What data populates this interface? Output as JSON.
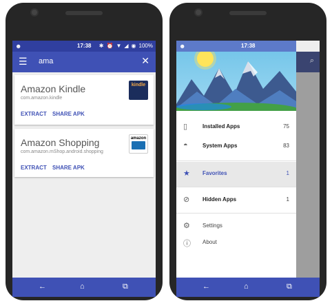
{
  "status": {
    "time": "17:38",
    "battery": "100%"
  },
  "search": {
    "query": "ama"
  },
  "cards": [
    {
      "title": "Amazon Kindle",
      "package": "com.amazon.kindle",
      "extract": "EXTRACT",
      "share": "SHARE APK",
      "thumb_text": "kindle"
    },
    {
      "title": "Amazon Shopping",
      "package": "com.amazon.mShop.android.shopping",
      "extract": "EXTRACT",
      "share": "SHARE APK",
      "thumb_text": "amazon"
    }
  ],
  "drawer": {
    "items": [
      {
        "label": "Installed Apps",
        "count": "75",
        "icon": "phone-icon"
      },
      {
        "label": "System Apps",
        "count": "83",
        "icon": "android-icon"
      },
      {
        "label": "Favorites",
        "count": "1",
        "icon": "star-icon"
      },
      {
        "label": "Hidden Apps",
        "count": "1",
        "icon": "eye-off-icon"
      },
      {
        "label": "Settings",
        "icon": "gear-icon"
      },
      {
        "label": "About",
        "icon": "info-icon"
      }
    ]
  },
  "colors": {
    "primary": "#3f51b5",
    "primary_dark": "#303f9f",
    "accent_active": "#3f51b5"
  }
}
